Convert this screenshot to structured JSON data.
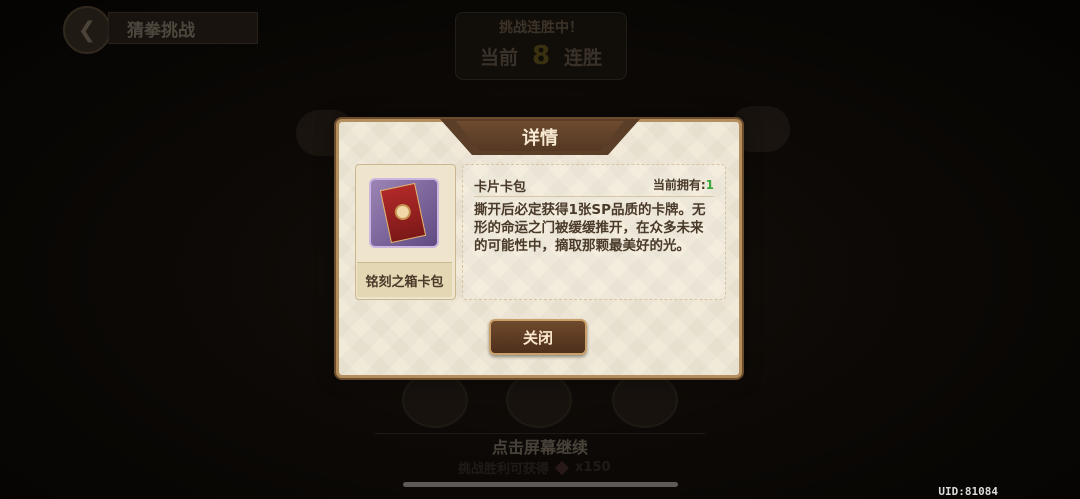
{
  "header": {
    "back_icon": "back-arrow-icon",
    "title": "猜拳挑战"
  },
  "streak": {
    "title": "挑战连胜中！",
    "prefix": "当前",
    "count": "8",
    "suffix": "连胜"
  },
  "footer": {
    "continue_text": "点击屏幕继续",
    "reward_text": "挑战胜利可获得",
    "reward_amount": "x150",
    "uid": "UID:81084"
  },
  "dialog": {
    "title": "详情",
    "item_name": "铭刻之箱卡包",
    "item_type": "卡片卡包",
    "owned_label": "当前拥有:",
    "owned_count": "1",
    "description": "撕开后必定获得1张SP品质的卡牌。无形的命运之门被缓缓推开，在众多未来的可能性中，摘取那颗最美好的光。",
    "close_label": "关闭"
  },
  "colors": {
    "dialog_bg": "#f2ead9",
    "accent_brown": "#5b3e27",
    "owned_green": "#3aa53a"
  }
}
